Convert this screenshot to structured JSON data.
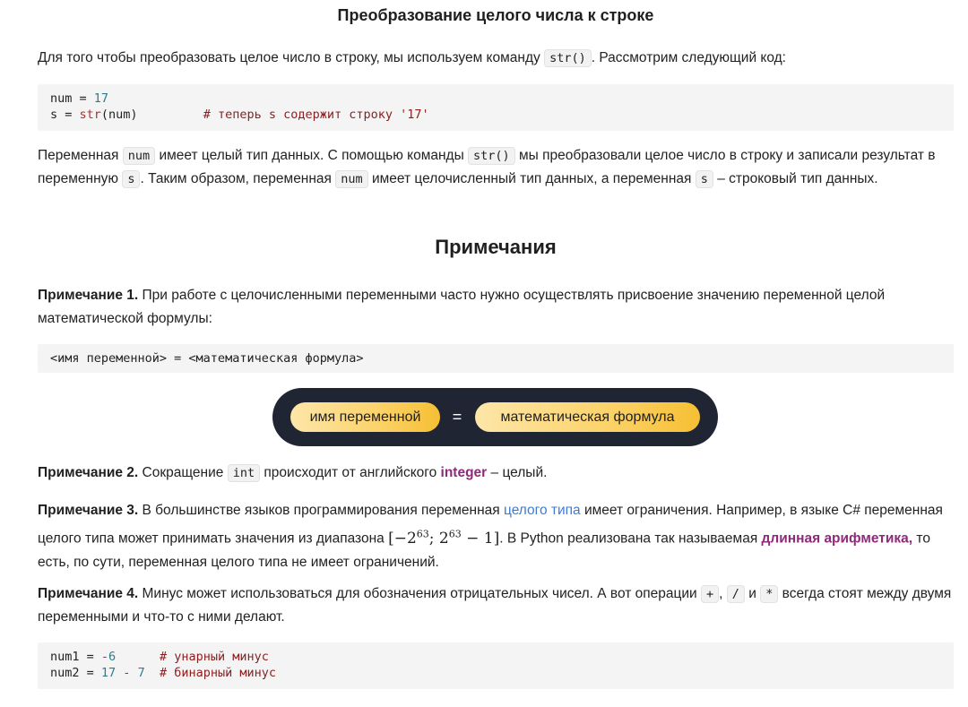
{
  "section_title": "Преобразование целого числа к строке",
  "intro": {
    "text_before": "Для того чтобы преобразовать целое число в строку, мы используем команду",
    "code": "str()",
    "text_after": ". Рассмотрим следующий код:"
  },
  "code_block_1": {
    "line1": {
      "var": "num",
      "op": " = ",
      "value": "17"
    },
    "line2": {
      "var": "s",
      "op": " = ",
      "fn": "str",
      "arg": "(num)",
      "comment": "# теперь s содержит строку '17'"
    }
  },
  "explanation": {
    "t1": "Переменная",
    "c1": "num",
    "t2": "имеет целый тип данных. С помощью команды",
    "c2": "str()",
    "t3": "мы преобразовали целое число в строку и записали результат в переменную",
    "c3": "s",
    "t4": ". Таким образом, переменная",
    "c4": "num",
    "t5": "имеет целочисленный тип данных, а переменная",
    "c5": "s",
    "t6": "– строковый тип данных."
  },
  "notes_title": "Примечания",
  "note1": {
    "label": "Примечание 1.",
    "text": "При работе с целочисленными переменными часто нужно осуществлять присвоение значению переменной целой математической формулы:"
  },
  "code_block_2": "<имя переменной> = <математическая формула>",
  "diagram": {
    "left_pill": "имя переменной",
    "equals": "=",
    "right_pill": "математическая формула"
  },
  "note2": {
    "label": "Примечание 2.",
    "t1": "Сокращение",
    "code": "int",
    "t2": "происходит от английского",
    "highlight": "integer",
    "t3": "– целый."
  },
  "note3": {
    "label": "Примечание 3.",
    "t1": "В большинстве языков программирования переменная",
    "link": "целого типа",
    "t2": "имеет ограничения. Например, в языке C# переменная целого типа может принимать значения из диапазона",
    "math_open": "[−2",
    "math_exp1": "63",
    "math_mid": "; 2",
    "math_exp2": "63",
    "math_close": " − 1]",
    "t3": ". В Python реализована так называемая",
    "highlight": "длинная арифметика,",
    "t4": "то есть, по сути, переменная целого типа не имеет ограничений."
  },
  "note4": {
    "label": "Примечание 4.",
    "t1": "Минус может использоваться для обозначения отрицательных чисел. А вот операции",
    "op1": "+",
    "sep1": ",",
    "op2": "/",
    "t2": "и",
    "op3": "*",
    "t3": "всегда стоят между двумя переменными и что-то с ними делают."
  },
  "code_block_3": {
    "line1": {
      "var": "num1",
      "op": " = ",
      "minus": "-",
      "value": "6",
      "comment": "# унарный минус"
    },
    "line2": {
      "var": "num2",
      "op": " = ",
      "v1": "17",
      "minus": " - ",
      "v2": "7",
      "comment": "# бинарный минус"
    }
  }
}
